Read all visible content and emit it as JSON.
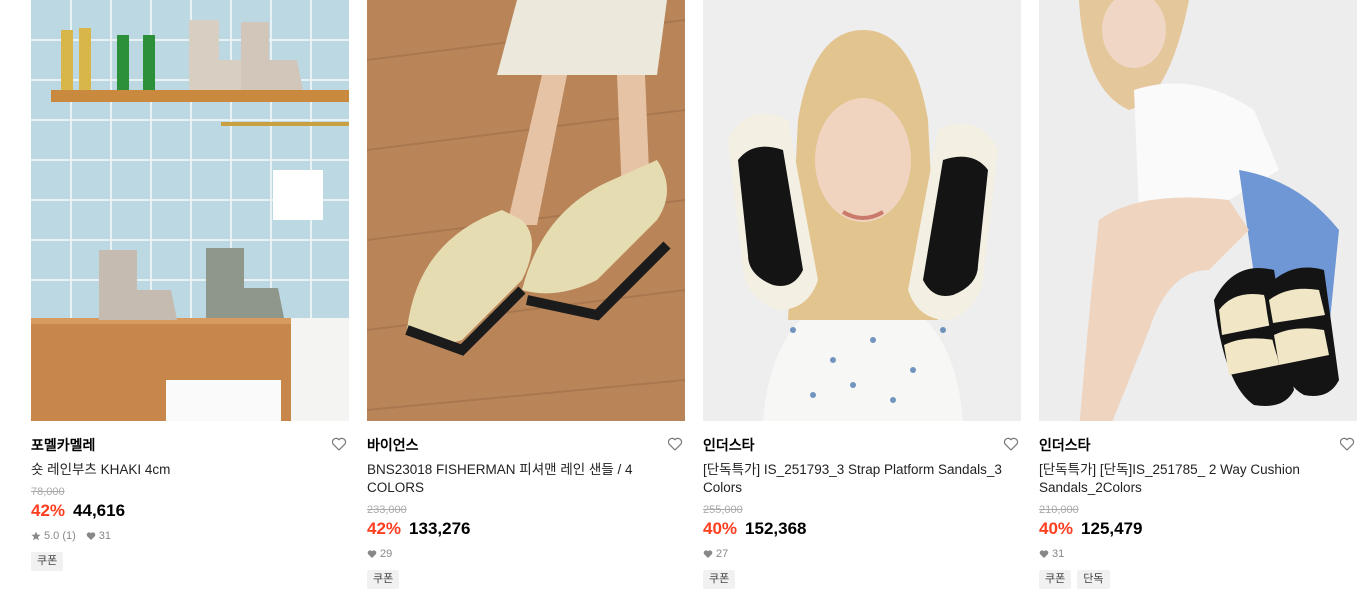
{
  "products": [
    {
      "brand": "포멜카멜레",
      "name": "숏 레인부츠 KHAKI 4cm",
      "original_price": "78,000",
      "discount": "42%",
      "price": "44,616",
      "rating": "5.0 (1)",
      "likes": "31",
      "tags": [
        "쿠폰"
      ]
    },
    {
      "brand": "바이언스",
      "name": "BNS23018 FISHERMAN 피셔맨 레인 샌들 / 4 COLORS",
      "original_price": "233,000",
      "discount": "42%",
      "price": "133,276",
      "likes": "29",
      "tags": [
        "쿠폰"
      ]
    },
    {
      "brand": "인더스타",
      "name": "[단독특가] IS_251793_3 Strap Platform Sandals_3 Colors",
      "original_price": "255,000",
      "discount": "40%",
      "price": "152,368",
      "likes": "27",
      "tags": [
        "쿠폰"
      ]
    },
    {
      "brand": "인더스타",
      "name": "[단독특가] [단독]IS_251785_ 2 Way Cushion Sandals_2Colors",
      "original_price": "210,000",
      "discount": "40%",
      "price": "125,479",
      "likes": "31",
      "tags": [
        "쿠폰",
        "단독"
      ]
    }
  ],
  "colors": {
    "discount": "#ff3d1f",
    "tag_bg": "#f1f1f1"
  },
  "icons": {
    "wishlist": "heart-outline-icon",
    "rating": "star-icon",
    "likes": "heart-filled-icon"
  }
}
